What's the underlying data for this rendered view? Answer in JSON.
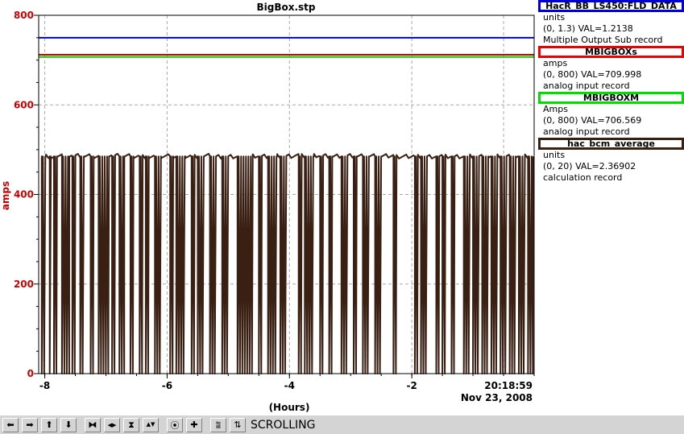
{
  "chart_data": {
    "type": "line",
    "title": "BigBox.stp",
    "xlabel": "(Hours)",
    "ylabel": "amps",
    "xlim": [
      -8.1,
      0
    ],
    "ylim": [
      0,
      800
    ],
    "x_ticks": [
      "-8",
      "-6",
      "-4",
      "-2"
    ],
    "y_ticks": [
      "0",
      "200",
      "400",
      "600",
      "800"
    ],
    "time_label": "20:18:59",
    "date_label": "Nov 23, 2008",
    "grid": true,
    "series": [
      {
        "name": "HacR_BB_LS450:FLD_DATA",
        "color": "#0000dd",
        "constant": 750
      },
      {
        "name": "MBIGBOXs",
        "color": "#cc0000",
        "constant": 712
      },
      {
        "name": "MBIGBOXM",
        "color": "#00cc00",
        "constant": 707
      },
      {
        "name": "hac_bcm_average",
        "color": "#3a2013",
        "baseline": 485,
        "dropouts": [
          [
            -8.05,
            -7.98
          ],
          [
            -7.92,
            -7.9
          ],
          [
            -7.85,
            -7.8
          ],
          [
            -7.72,
            -7.6
          ],
          [
            -7.55,
            -7.5
          ],
          [
            -7.42,
            -7.35
          ],
          [
            -7.25,
            -7.2
          ],
          [
            -7.12,
            -6.95
          ],
          [
            -6.9,
            -6.85
          ],
          [
            -6.78,
            -6.7
          ],
          [
            -6.6,
            -6.55
          ],
          [
            -6.45,
            -6.4
          ],
          [
            -6.35,
            -6.3
          ],
          [
            -6.2,
            -6.1
          ],
          [
            -5.95,
            -5.9
          ],
          [
            -5.85,
            -5.7
          ],
          [
            -5.6,
            -5.55
          ],
          [
            -5.5,
            -5.4
          ],
          [
            -5.3,
            -5.2
          ],
          [
            -5.1,
            -5.0
          ],
          [
            -4.85,
            -4.6
          ],
          [
            -4.5,
            -4.45
          ],
          [
            -4.35,
            -4.2
          ],
          [
            -4.15,
            -4.05
          ],
          [
            -3.85,
            -3.8
          ],
          [
            -3.75,
            -3.6
          ],
          [
            -3.5,
            -3.45
          ],
          [
            -3.35,
            -3.3
          ],
          [
            -3.15,
            -3.05
          ],
          [
            -2.95,
            -2.9
          ],
          [
            -2.8,
            -2.7
          ],
          [
            -2.6,
            -2.5
          ],
          [
            -2.3,
            -2.25
          ],
          [
            -1.95,
            -1.9
          ],
          [
            -1.85,
            -1.75
          ],
          [
            -1.6,
            -1.55
          ],
          [
            -1.5,
            -1.45
          ],
          [
            -1.35,
            -1.3
          ],
          [
            -1.15,
            -1.05
          ],
          [
            -1.0,
            -0.9
          ],
          [
            -0.85,
            -0.75
          ],
          [
            -0.7,
            -0.6
          ],
          [
            -0.55,
            -0.45
          ],
          [
            -0.4,
            -0.3
          ],
          [
            -0.25,
            -0.15
          ],
          [
            -0.1,
            -0.02
          ]
        ]
      }
    ]
  },
  "legend": [
    {
      "name": "HacR_BB_LS450:FLD_DATA",
      "color": "#0000dd",
      "units": "units",
      "range": "(0, 1.3) VAL=1.2138",
      "desc": "Multiple Output Sub record"
    },
    {
      "name": "MBIGBOXs",
      "color": "#ee0000",
      "units": "amps",
      "range": "(0, 800) VAL=709.998",
      "desc": "analog input record"
    },
    {
      "name": "MBIGBOXM",
      "color": "#00dd00",
      "units": "Amps",
      "range": "(0, 800) VAL=706.569",
      "desc": "analog input record"
    },
    {
      "name": "hac_bcm_average",
      "color": "#3a2013",
      "units": "units",
      "range": "(0, 20) VAL=2.36902",
      "desc": "calculation record"
    }
  ],
  "toolbar": {
    "buttons": [
      {
        "name": "scroll-left-icon",
        "glyph": "⬅"
      },
      {
        "name": "scroll-right-icon",
        "glyph": "➡"
      },
      {
        "name": "scroll-up-icon",
        "glyph": "⬆"
      },
      {
        "name": "scroll-down-icon",
        "glyph": "⬇"
      },
      {
        "name": "zoom-in-horizontal-icon",
        "glyph": "⧓"
      },
      {
        "name": "zoom-out-horizontal-icon",
        "glyph": "◀▶"
      },
      {
        "name": "zoom-in-vertical-icon",
        "glyph": "⧗"
      },
      {
        "name": "zoom-out-vertical-icon",
        "glyph": "▲▼"
      },
      {
        "name": "stop-icon",
        "glyph": "⦿"
      },
      {
        "name": "add-icon",
        "glyph": "✚"
      },
      {
        "name": "reset-view-icon",
        "glyph": "⩰"
      },
      {
        "name": "scroll-mode-icon",
        "glyph": "⇅"
      }
    ],
    "status": "SCROLLING"
  }
}
